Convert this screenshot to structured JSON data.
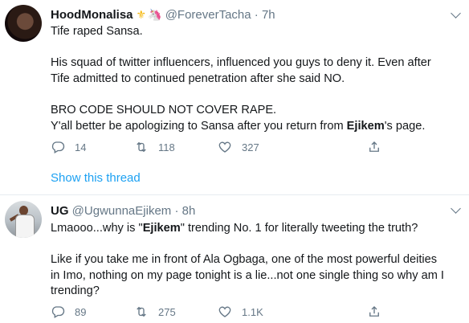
{
  "tweets": [
    {
      "name": "HoodMonalisa",
      "emoji1": "⚜",
      "emoji2": "🦄",
      "handle": "@ForeverTacha",
      "time": "7h",
      "lines": [
        "Tife raped Sansa.",
        "",
        "His squad of twitter influencers, influenced you guys to deny it. Even after",
        "Tife admitted to continued penetration after she said NO.",
        "",
        "BRO CODE SHOULD NOT COVER RAPE.",
        "Y'all better be apologizing to Sansa after you return from **Ejikem**'s page."
      ],
      "replies": "14",
      "retweets": "118",
      "likes": "327",
      "show_thread": "Show this thread"
    },
    {
      "name": "UG",
      "handle": "@UgwunnaEjikem",
      "time": "8h",
      "lines": [
        "Lmaooo...why is \"**Ejikem**\" trending No. 1 for literally tweeting the truth?",
        "",
        "Like if you take me in front of Ala Ogbaga, one of the most powerful deities",
        "in Imo, nothing on my page tonight is a lie...not one single thing so why am I",
        "trending?"
      ],
      "replies": "89",
      "retweets": "275",
      "likes": "1.1K"
    }
  ],
  "colors": {
    "accent": "#1da1f2",
    "muted": "#657786",
    "text": "#14171a",
    "divider": "#e6ecf0"
  }
}
